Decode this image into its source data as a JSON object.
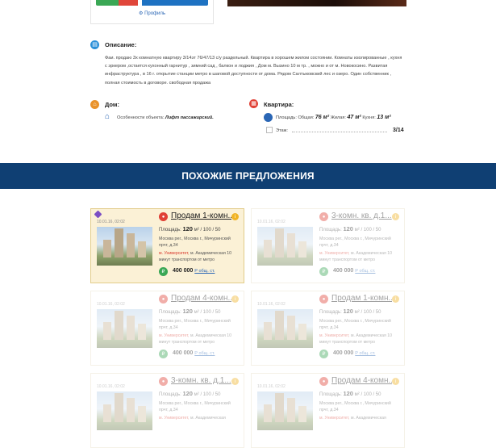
{
  "top": {
    "profile_label": "Профиль"
  },
  "description": {
    "title": "Описание:",
    "text": "Фаи. продаю 3х комнатную квартиру 3/14эт 76/47/13 с/у раздельный. Квартира в хорошем жилом состоянии. Комнаты изолированные , кухня с эркером ,остается кухонный гарнитур , зимний сад , балкон и лоджия , Дом м. Вызино 10 м тр. , можно и от м. Новокосино. Развитая инфраструктура , в 16 г. открытие станции метро в шаговой доступности от дома. Рядом Салтыковский лес и озеро. Один собственник , полная стоимость в договоре. свободная продажа"
  },
  "house": {
    "title": "Дом:",
    "feature_label": "Особенности объекта:",
    "feature_value": "Лифт пассажирский."
  },
  "flat": {
    "title": "Квартира:",
    "area_label": "Площадь: Общая:",
    "area_total": "76 м²",
    "area_living_label": "Жилая:",
    "area_living": "47 м²",
    "area_kitchen_label": "Кухня:",
    "area_kitchen": "13 м²",
    "floor_label": "Этаж:",
    "floor_value": "3/14"
  },
  "similar": {
    "heading": "ПОХОЖИЕ ПРЕДЛОЖЕНИЯ",
    "cards": [
      {
        "date": "10.01.16, 02:02",
        "title": "Продам 1-комн...",
        "area_label": "Площадь:",
        "area": "120",
        "area_rest": "м² / 100 / 50",
        "address": "Москва рег., Москва г., Мичуринский прчт, д.34",
        "metro_label": "м. Университет,",
        "metro_rest": "м. Академическая 10 минут транспортом от метро",
        "price": "400 000",
        "price_unit": "Р общ. ст."
      },
      {
        "date": "10.01.16, 02:02",
        "title": "3-комн. кв. д.1...",
        "area_label": "Площадь:",
        "area": "120",
        "area_rest": "м² / 100 / 50",
        "address": "Москва рег., Москва г., Мичуринский прчт, д.34",
        "metro_label": "м. Университет,",
        "metro_rest": "м. Академическая 10 минут транспортом от метро",
        "price": "400 000",
        "price_unit": "Р общ. ст."
      },
      {
        "date": "10.01.16, 02:02",
        "title": "Продам 4-комн...",
        "area_label": "Площадь:",
        "area": "120",
        "area_rest": "м² / 100 / 50",
        "address": "Москва рег., Москва г., Мичуринский прчт, д.34",
        "metro_label": "м. Университет,",
        "metro_rest": "м. Академическая 10 минут транспортом от метро",
        "price": "400 000",
        "price_unit": "Р общ. ст."
      },
      {
        "date": "10.01.16, 02:02",
        "title": "Продам 1-комн...",
        "area_label": "Площадь:",
        "area": "120",
        "area_rest": "м² / 100 / 50",
        "address": "Москва рег., Москва г., Мичуринский прчт, д.34",
        "metro_label": "м. Университет,",
        "metro_rest": "м. Академическая 10 минут транспортом от метро",
        "price": "400 000",
        "price_unit": "Р общ. ст."
      },
      {
        "date": "10.01.16, 02:02",
        "title": "3-комн. кв. д.1...",
        "area_label": "Площадь:",
        "area": "120",
        "area_rest": "м² / 100 / 50",
        "address": "Москва рег., Москва г., Мичуринский прчт, д.34",
        "metro_label": "м. Университет,",
        "metro_rest": "м. Академическая",
        "price": "",
        "price_unit": ""
      },
      {
        "date": "10.01.16, 02:02",
        "title": "Продам 4-комн...",
        "area_label": "Площадь:",
        "area": "120",
        "area_rest": "м² / 100 / 50",
        "address": "Москва рег., Москва г., Мичуринский прчт, д.34",
        "metro_label": "м. Университет,",
        "metro_rest": "м. Академическая",
        "price": "",
        "price_unit": ""
      }
    ]
  },
  "colors": {
    "band": "#0f3f73",
    "accent_red": "#e04035",
    "accent_green": "#3aa755",
    "accent_orange": "#f0b323",
    "link": "#2a66b5"
  }
}
